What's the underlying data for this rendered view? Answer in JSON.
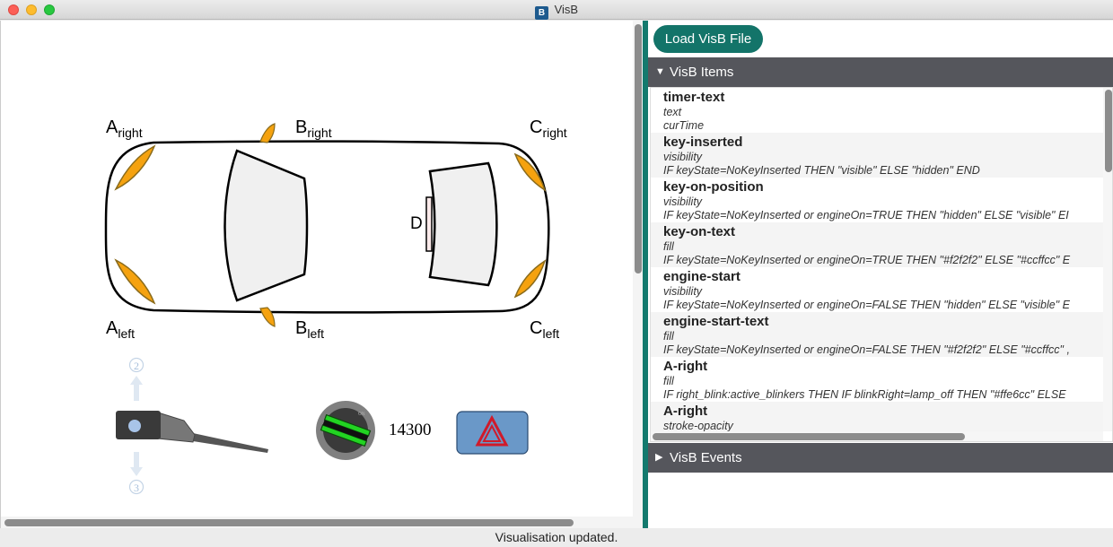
{
  "window": {
    "title": "VisB",
    "app_icon_text": "B"
  },
  "labels": {
    "a_right": {
      "main": "A",
      "sub": "right"
    },
    "b_right": {
      "main": "B",
      "sub": "right"
    },
    "c_right": {
      "main": "C",
      "sub": "right"
    },
    "a_left": {
      "main": "A",
      "sub": "left"
    },
    "b_left": {
      "main": "B",
      "sub": "left"
    },
    "c_left": {
      "main": "C",
      "sub": "left"
    },
    "d": "D"
  },
  "controls": {
    "lever_up": "2",
    "lever_down": "3",
    "timer": "14300"
  },
  "colors": {
    "accent": "#137469",
    "blinker": "#f5a20f",
    "key_green": "#22d422",
    "hazard_bg": "#6a98c8",
    "hazard_tri": "#d01a2a",
    "header_bg": "#55565c"
  },
  "right": {
    "load_button": "Load VisB File",
    "items_header": "VisB Items",
    "events_header": "VisB Events",
    "items": [
      {
        "name": "timer-text",
        "attr": "text",
        "expr": "curTime"
      },
      {
        "name": "key-inserted",
        "attr": "visibility",
        "expr": "IF keyState=NoKeyInserted THEN \"visible\" ELSE \"hidden\" END"
      },
      {
        "name": "key-on-position",
        "attr": "visibility",
        "expr": "IF keyState=NoKeyInserted or engineOn=TRUE THEN \"hidden\" ELSE \"visible\" EI"
      },
      {
        "name": "key-on-text",
        "attr": "fill",
        "expr": "IF keyState=NoKeyInserted or engineOn=TRUE THEN \"#f2f2f2\" ELSE \"#ccffcc\" E"
      },
      {
        "name": "engine-start",
        "attr": "visibility",
        "expr": "IF keyState=NoKeyInserted or engineOn=FALSE THEN \"hidden\" ELSE \"visible\" E"
      },
      {
        "name": "engine-start-text",
        "attr": "fill",
        "expr": "IF keyState=NoKeyInserted or engineOn=FALSE THEN \"#f2f2f2\" ELSE \"#ccffcc\" ,"
      },
      {
        "name": "A-right",
        "attr": "fill",
        "expr": "IF right_blink:active_blinkers THEN IF blinkRight=lamp_off THEN \"#ffe6cc\" ELSE"
      },
      {
        "name": "A-right",
        "attr": "stroke-opacity",
        "expr": ""
      }
    ]
  },
  "status": "Visualisation updated."
}
